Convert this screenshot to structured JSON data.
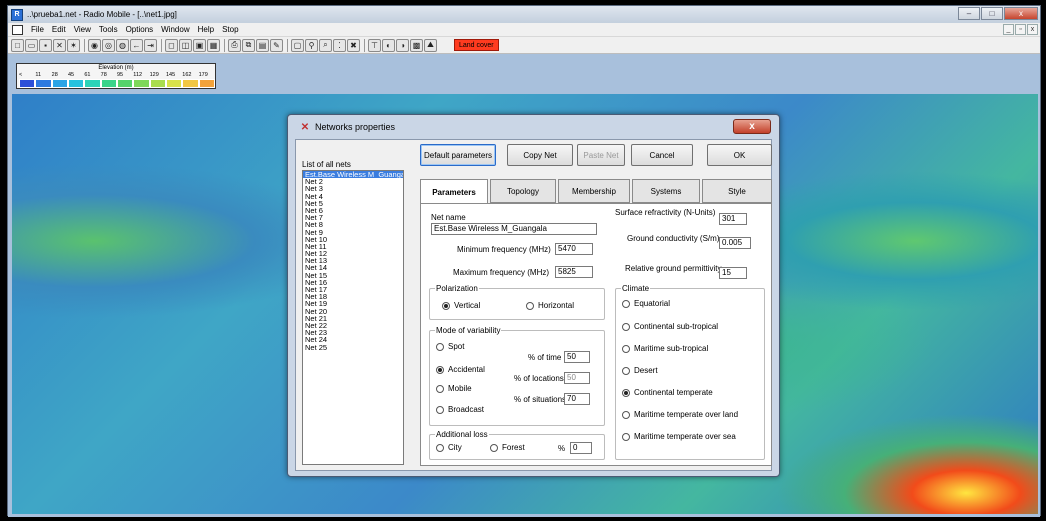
{
  "window": {
    "title": "..\\prueba1.net - Radio Mobile - [..\\net1.jpg]",
    "app_icon": "R",
    "min": "–",
    "max": "□",
    "close": "x"
  },
  "menu": {
    "items": [
      "File",
      "Edit",
      "View",
      "Tools",
      "Options",
      "Window",
      "Help",
      "Stop"
    ],
    "mdi_controls": [
      "_",
      "▫",
      "x"
    ]
  },
  "toolbar": {
    "land_cover_label": "Land cover"
  },
  "legend": {
    "title": "Elevation (m)",
    "labels": [
      "<",
      "11",
      "28",
      "45",
      "61",
      "78",
      "95",
      "112",
      "129",
      "145",
      "162",
      "179"
    ],
    "colors": [
      "#2c4fd8",
      "#2d7ae0",
      "#2aa4e6",
      "#27c2de",
      "#2bd3b8",
      "#3ad48a",
      "#55d46a",
      "#7ed85a",
      "#a9dd4e",
      "#d8e24a",
      "#f2c743",
      "#f2a23a"
    ]
  },
  "dialog": {
    "title": "Networks properties",
    "close_label": "x",
    "list_label": "List of all nets",
    "nets": [
      "Est.Base Wireless M_Guangala",
      "Net 2",
      "Net 3",
      "Net 4",
      "Net 5",
      "Net 6",
      "Net 7",
      "Net 8",
      "Net 9",
      "Net 10",
      "Net 11",
      "Net 12",
      "Net 13",
      "Net 14",
      "Net 15",
      "Net 16",
      "Net 17",
      "Net 18",
      "Net 19",
      "Net 20",
      "Net 21",
      "Net 22",
      "Net 23",
      "Net 24",
      "Net 25"
    ],
    "buttons": {
      "default_params": "Default parameters",
      "copy_net": "Copy Net",
      "paste_net": "Paste Net",
      "cancel": "Cancel",
      "ok": "OK"
    },
    "tabs": [
      "Parameters",
      "Topology",
      "Membership",
      "Systems",
      "Style"
    ],
    "params": {
      "net_name_label": "Net name",
      "net_name_value": "Est.Base Wireless M_Guangala",
      "min_freq_label": "Minimum frequency (MHz)",
      "min_freq_value": "5470",
      "max_freq_label": "Maximum frequency (MHz)",
      "max_freq_value": "5825",
      "surface_refr_label": "Surface refractivity (N-Units)",
      "surface_refr_value": "301",
      "ground_cond_label": "Ground conductivity (S/m)",
      "ground_cond_value": "0.005",
      "rel_perm_label": "Relative ground permittivity",
      "rel_perm_value": "15",
      "polarization_title": "Polarization",
      "pol_vertical": "Vertical",
      "pol_horizontal": "Horizontal",
      "variability_title": "Mode of variability",
      "var_spot": "Spot",
      "var_accidental": "Accidental",
      "var_mobile": "Mobile",
      "var_broadcast": "Broadcast",
      "pct_time_label": "% of time",
      "pct_time_value": "50",
      "pct_locations_label": "% of locations",
      "pct_locations_value": "50",
      "pct_situations_label": "% of situations",
      "pct_situations_value": "70",
      "additional_loss_title": "Additional loss",
      "loss_city": "City",
      "loss_forest": "Forest",
      "loss_pct_label": "%",
      "loss_pct_value": "0",
      "climate_title": "Climate",
      "climate_options": [
        "Equatorial",
        "Continental sub-tropical",
        "Maritime sub-tropical",
        "Desert",
        "Continental temperate",
        "Maritime temperate over land",
        "Maritime temperate over sea"
      ]
    }
  }
}
